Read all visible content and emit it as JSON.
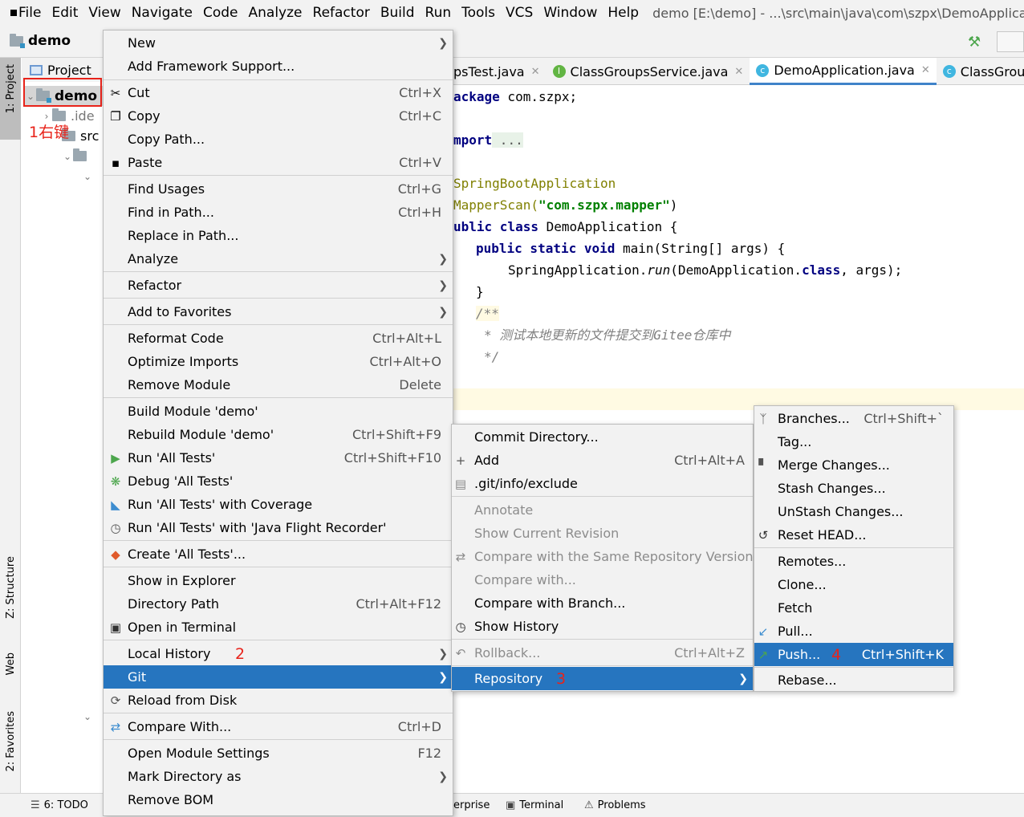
{
  "window": {
    "title": "demo [E:\\demo] - ...\\src\\main\\java\\com\\szpx\\DemoApplication."
  },
  "menubar": [
    "File",
    "Edit",
    "View",
    "Navigate",
    "Code",
    "Analyze",
    "Refactor",
    "Build",
    "Run",
    "Tools",
    "VCS",
    "Window",
    "Help"
  ],
  "navbar": {
    "root": "demo"
  },
  "side_tabs": {
    "project": "1: Project",
    "structure": "Z: Structure",
    "web": "Web",
    "favorites": "2: Favorites"
  },
  "project_panel": {
    "header": "Project",
    "tree": [
      {
        "label": "demo"
      },
      {
        "label": ".ide"
      },
      {
        "label": "src"
      }
    ]
  },
  "annotations": {
    "step1": "1右键",
    "step2": "2",
    "step3": "3",
    "step4": "4"
  },
  "editor_tabs": [
    {
      "label": "psTest.java",
      "icon": "class-icon"
    },
    {
      "label": "ClassGroupsService.java",
      "icon": "interface-icon"
    },
    {
      "label": "DemoApplication.java",
      "icon": "class-icon"
    },
    {
      "label": "ClassGroupsSe",
      "icon": "class-icon"
    }
  ],
  "code": {
    "l1a": "ackage",
    "l1b": " com.szpx;",
    "l2a": "mport",
    "l2b": " ...",
    "l3": "SpringBootApplication",
    "l4a": "MapperScan(",
    "l4b": "\"com.szpx.mapper\"",
    "l4c": ")",
    "l5a": "ublic class",
    "l5b": " DemoApplication {",
    "l6a": "public static void",
    "l6b": " main(String[] args) {",
    "l7a": "SpringApplication.",
    "l7b": "run",
    "l7c": "(DemoApplication.",
    "l7d": "class",
    "l7e": ", args);",
    "l8": "}",
    "l9": "/**",
    "l10": "* 测试本地更新的文件提交到Gitee仓库中",
    "l11": "*/"
  },
  "context_menu": {
    "new": "New",
    "add_framework": "Add Framework Support...",
    "cut": "Cut",
    "cut_sc": "Ctrl+X",
    "copy": "Copy",
    "copy_sc": "Ctrl+C",
    "copy_path": "Copy Path...",
    "paste": "Paste",
    "paste_sc": "Ctrl+V",
    "find_usages": "Find Usages",
    "find_usages_sc": "Ctrl+G",
    "find_in_path": "Find in Path...",
    "find_in_path_sc": "Ctrl+H",
    "replace_in_path": "Replace in Path...",
    "analyze": "Analyze",
    "refactor": "Refactor",
    "add_favorites": "Add to Favorites",
    "reformat": "Reformat Code",
    "reformat_sc": "Ctrl+Alt+L",
    "optimize": "Optimize Imports",
    "optimize_sc": "Ctrl+Alt+O",
    "remove_module": "Remove Module",
    "remove_module_sc": "Delete",
    "build_module": "Build Module 'demo'",
    "rebuild_module": "Rebuild Module 'demo'",
    "rebuild_module_sc": "Ctrl+Shift+F9",
    "run_tests": "Run 'All Tests'",
    "run_tests_sc": "Ctrl+Shift+F10",
    "debug_tests": "Debug 'All Tests'",
    "run_coverage": "Run 'All Tests' with Coverage",
    "run_jfr": "Run 'All Tests' with 'Java Flight Recorder'",
    "create_tests": "Create 'All Tests'...",
    "show_explorer": "Show in Explorer",
    "dir_path": "Directory Path",
    "dir_path_sc": "Ctrl+Alt+F12",
    "open_terminal": "Open in Terminal",
    "local_history": "Local History",
    "git": "Git",
    "reload": "Reload from Disk",
    "compare_with": "Compare With...",
    "compare_with_sc": "Ctrl+D",
    "module_settings": "Open Module Settings",
    "module_settings_sc": "F12",
    "mark_dir": "Mark Directory as",
    "remove_bom": "Remove BOM"
  },
  "git_menu": {
    "commit_dir": "Commit Directory...",
    "add": "Add",
    "add_sc": "Ctrl+Alt+A",
    "exclude": ".git/info/exclude",
    "annotate": "Annotate",
    "show_rev": "Show Current Revision",
    "compare_same": "Compare with the Same Repository Version",
    "compare_with": "Compare with...",
    "compare_branch": "Compare with Branch...",
    "show_history": "Show History",
    "rollback": "Rollback...",
    "rollback_sc": "Ctrl+Alt+Z",
    "repository": "Repository"
  },
  "repo_menu": {
    "branches": "Branches...",
    "branches_sc": "Ctrl+Shift+`",
    "tag": "Tag...",
    "merge": "Merge Changes...",
    "stash": "Stash Changes...",
    "unstash": "UnStash Changes...",
    "reset": "Reset HEAD...",
    "remotes": "Remotes...",
    "clone": "Clone...",
    "fetch": "Fetch",
    "pull": "Pull...",
    "push": "Push...",
    "push_sc": "Ctrl+Shift+K",
    "rebase": "Rebase..."
  },
  "statusbar": {
    "todo": "6: TODO",
    "enterprise": "erprise",
    "terminal": "Terminal",
    "problems": "Problems"
  },
  "colors": {
    "selection": "#2675bf",
    "annotation_red": "#e8231a",
    "keyword": "#000080",
    "string": "#008000",
    "annotation": "#808000"
  }
}
